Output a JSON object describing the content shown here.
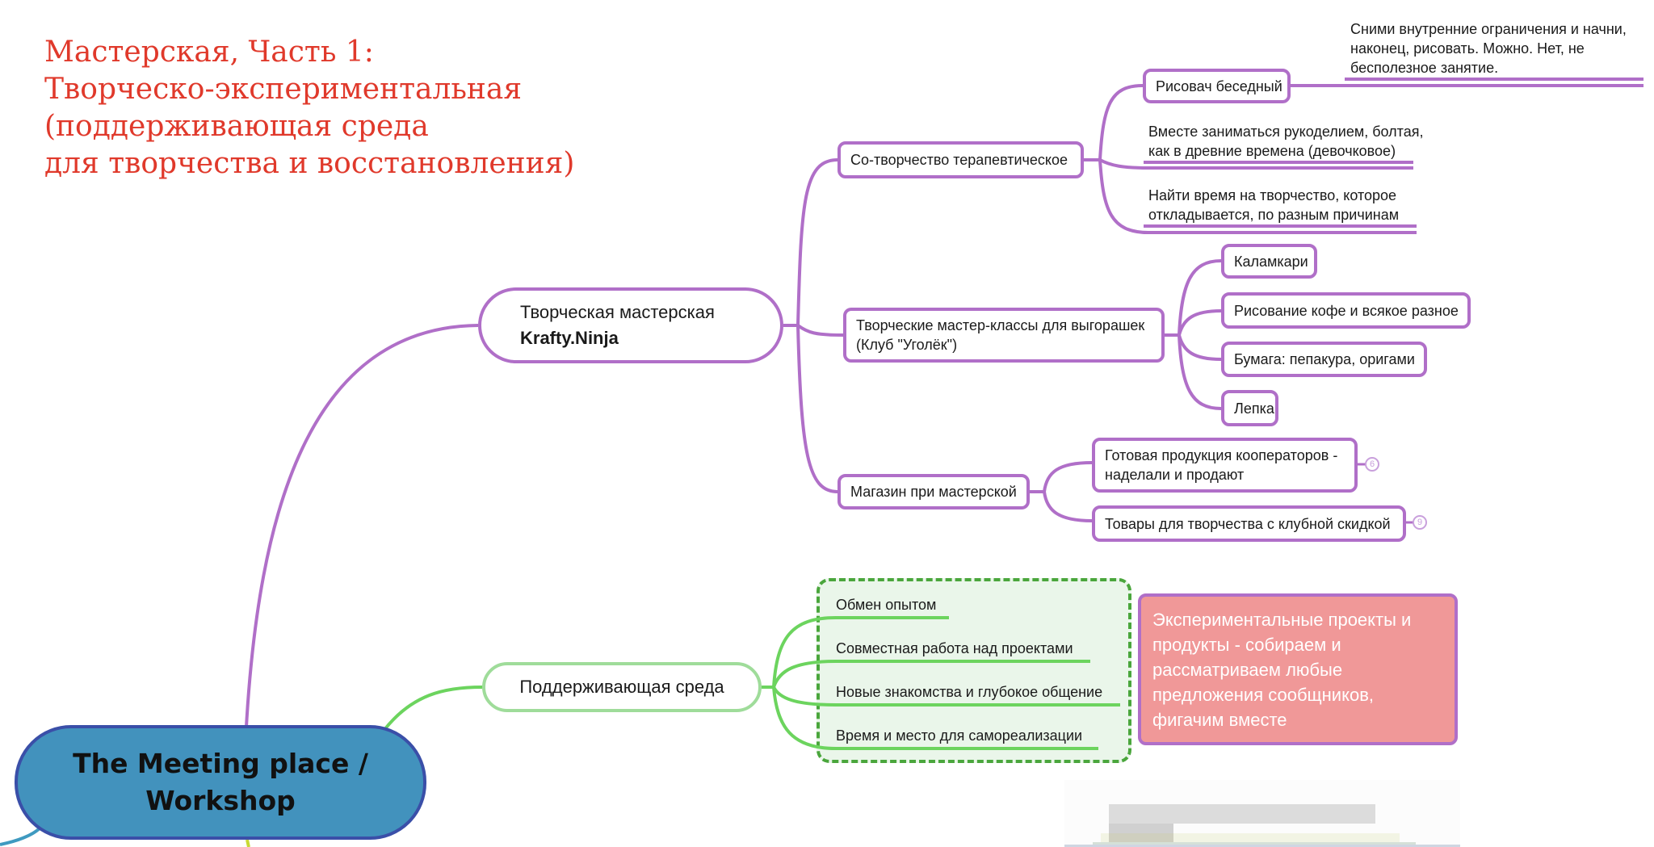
{
  "title": {
    "lines": [
      "Мастерская, Часть 1:",
      "Творческо-экспериментальная",
      "(поддерживающая среда",
      "для творчества и восстановления)"
    ],
    "color": "#e0392b"
  },
  "colors": {
    "purple_branch": "#b06fc8",
    "green_branch": "#6cd45e",
    "root_fill": "#4292bd",
    "root_border": "#3a4fa8",
    "group_border": "#4aa63c",
    "group_fill": "#eaf6ea",
    "note_fill": "#f09898"
  },
  "root": {
    "lines": [
      "The Meeting place /",
      "Workshop"
    ]
  },
  "krafty": {
    "line1": "Творческая мастерская",
    "line2": "Krafty.Ninja",
    "children": {
      "cotvorchestvo": {
        "label": "Со-творчество терапевтическое",
        "risovach": "Рисовач беседный",
        "risovach_note": [
          "Сними внутренние ограничения и начни,",
          "наконец, рисовать. Можно. Нет, не",
          "бесполезное занятие."
        ],
        "vmeste": [
          "Вместе заниматься рукоделием, болтая,",
          "как в древние времена (девочковое)"
        ],
        "naiti": [
          "Найти время на творчество, которое",
          "откладывается, по разным причинам"
        ]
      },
      "masterclasses": {
        "lines": [
          "Творческие мастер-классы для выгорашек",
          "(Клуб \"Уголёк\")"
        ],
        "items": [
          "Каламкари",
          "Рисование кофе и всякое разное",
          "Бумага: пепакура, оригами",
          "Лепка"
        ]
      },
      "shop": {
        "label": "Магазин при мастерской",
        "ready": [
          "Готовая продукция кооператоров -",
          "наделали и продают"
        ],
        "ready_count": "6",
        "goods": "Товары для творчества с клубной скидкой",
        "goods_count": "9"
      }
    }
  },
  "support": {
    "label": "Поддерживающая среда",
    "items": [
      "Обмен опытом",
      "Совместная работа над проектами",
      "Новые знакомства и глубокое общение",
      "Время и место для самореализации"
    ]
  },
  "note": {
    "lines": [
      "Экспериментальные проекты и",
      "продукты - собираем и",
      "рассматриваем любые",
      "предложения сообщников,",
      "фигачим вместе"
    ]
  }
}
